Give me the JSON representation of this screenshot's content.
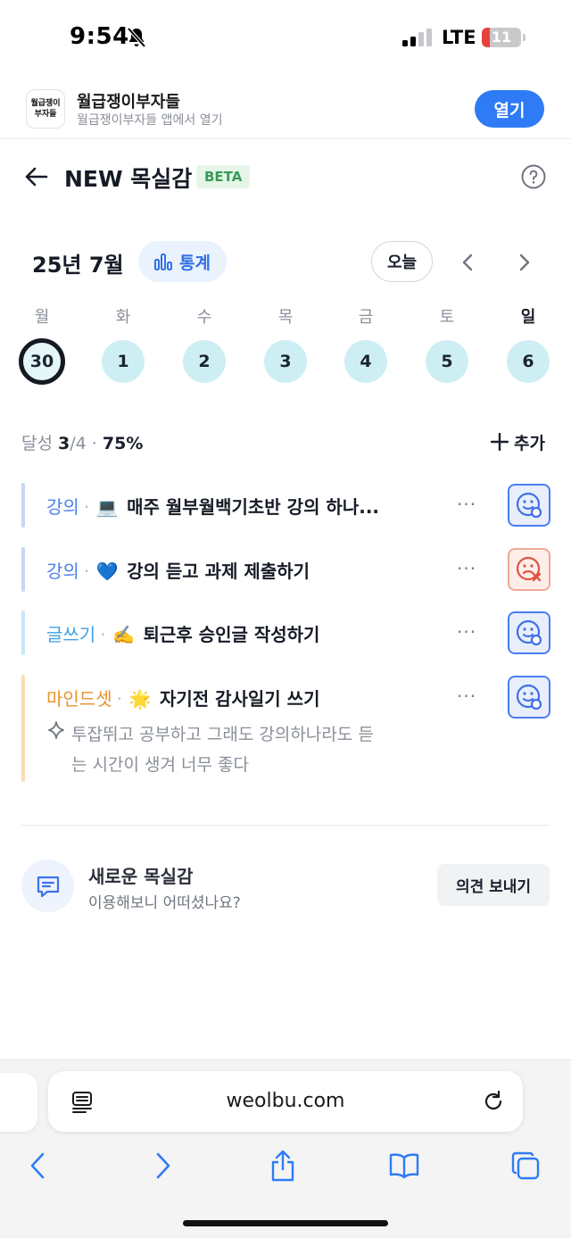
{
  "status_bar": {
    "time": "9:54",
    "network": "LTE",
    "battery": "11",
    "battery_level": 0.11
  },
  "app_banner": {
    "logo_line1": "월급쟁이",
    "logo_line2": "부자들",
    "name": "월급쟁이부자들",
    "subtitle": "월급쟁이부자들 앱에서 열기",
    "open_label": "열기"
  },
  "header": {
    "title": "NEW 목실감",
    "badge": "BETA"
  },
  "calendar": {
    "month": "25년 7월",
    "stats_label": "통계",
    "today_label": "오늘",
    "weekdays": [
      "월",
      "화",
      "수",
      "목",
      "금",
      "토",
      "일"
    ],
    "days": [
      "30",
      "1",
      "2",
      "3",
      "4",
      "5",
      "6"
    ],
    "selected_index": 0
  },
  "progress": {
    "label": "달성",
    "done": "3",
    "total": "/4",
    "separator": "·",
    "percent": "75%",
    "add_label": "추가"
  },
  "goals": [
    {
      "category": "강의",
      "emoji": "💻",
      "text": "매주 월부월백기초반 강의 하나...",
      "status": "done",
      "category_color": "#4a7ef0",
      "bar_color": "#c9d6f7"
    },
    {
      "category": "강의",
      "emoji": "💙",
      "text": "강의 듣고 과제 제출하기",
      "status": "fail",
      "category_color": "#4a7ef0",
      "bar_color": "#c9d6f7"
    },
    {
      "category": "글쓰기",
      "emoji": "✍️",
      "text": "퇴근후 승인글 작성하기",
      "status": "done",
      "category_color": "#3fa1e6",
      "bar_color": "#c7e6f7"
    },
    {
      "category": "마인드셋",
      "emoji": "🌟",
      "text": "자기전 감사일기 쓰기",
      "status": "done",
      "category_color": "#e8922c",
      "bar_color": "#fbdcb4",
      "note_line1": "투잡뛰고 공부하고 그래도 강의하나라도 듣",
      "note_line2": "는 시간이 생겨 너무 좋다"
    }
  ],
  "feedback": {
    "title": "새로운 목실감",
    "subtitle": "이용해보니 어떠셨나요?",
    "button": "의견 보내기"
  },
  "browser": {
    "url": "weolbu.com"
  },
  "colors": {
    "accent": "#2f7bf5",
    "day_bg": "#cdeff4",
    "beta_bg": "#e5f6e8"
  }
}
